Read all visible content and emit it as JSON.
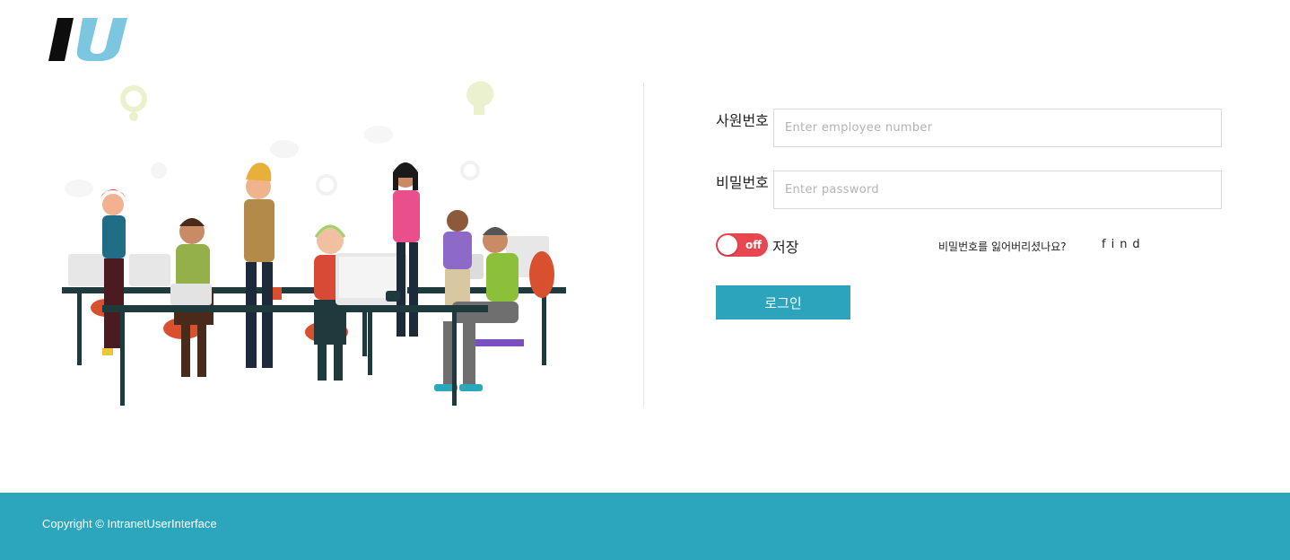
{
  "logo": {
    "text": "IU",
    "colors": {
      "i": "#0d0d0d",
      "u": "#7cc6df"
    }
  },
  "form": {
    "employee_label": "사원번호",
    "employee_placeholder": "Enter employee number",
    "password_label": "비밀번호",
    "password_placeholder": "Enter password",
    "toggle_state": "off",
    "save_label": "저장",
    "forgot_text": "비밀번호를 잃어버리셨나요?",
    "find_label": "find",
    "login_label": "로그인"
  },
  "footer": {
    "copyright": "Copyright © IntranetUserInterface"
  },
  "colors": {
    "accent": "#2ba4bc",
    "toggle_off": "#e8474f"
  }
}
